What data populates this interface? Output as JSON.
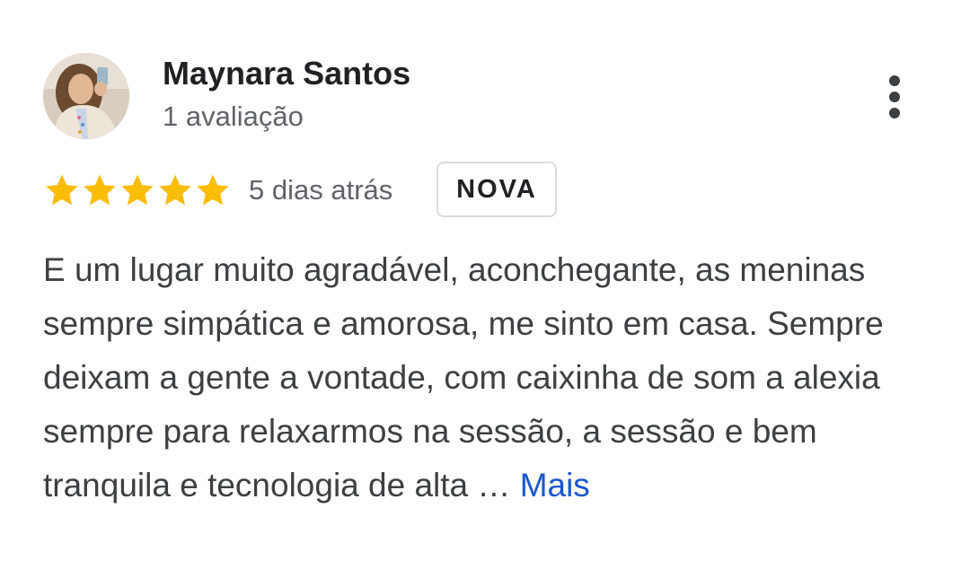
{
  "reviewer": {
    "name": "Maynara Santos",
    "review_count": "1 avaliação",
    "avatar_icon": "profile-photo"
  },
  "rating": {
    "stars": 5,
    "max_stars": 5,
    "star_color": "#FBBC04",
    "date": "5 dias atrás",
    "badge": "NOVA"
  },
  "review": {
    "text": "E um lugar muito agradável, aconchegante, as meninas sempre simpática e amorosa, me sinto em casa. Sempre deixam a gente a vontade, com caixinha de som a alexia sempre para relaxarmos na sessão, a sessão e bem tranquila e tecnologia de alta …",
    "more_label": "Mais",
    "link_color": "#1A57D0"
  },
  "menu": {
    "icon": "more-vert-icon"
  }
}
